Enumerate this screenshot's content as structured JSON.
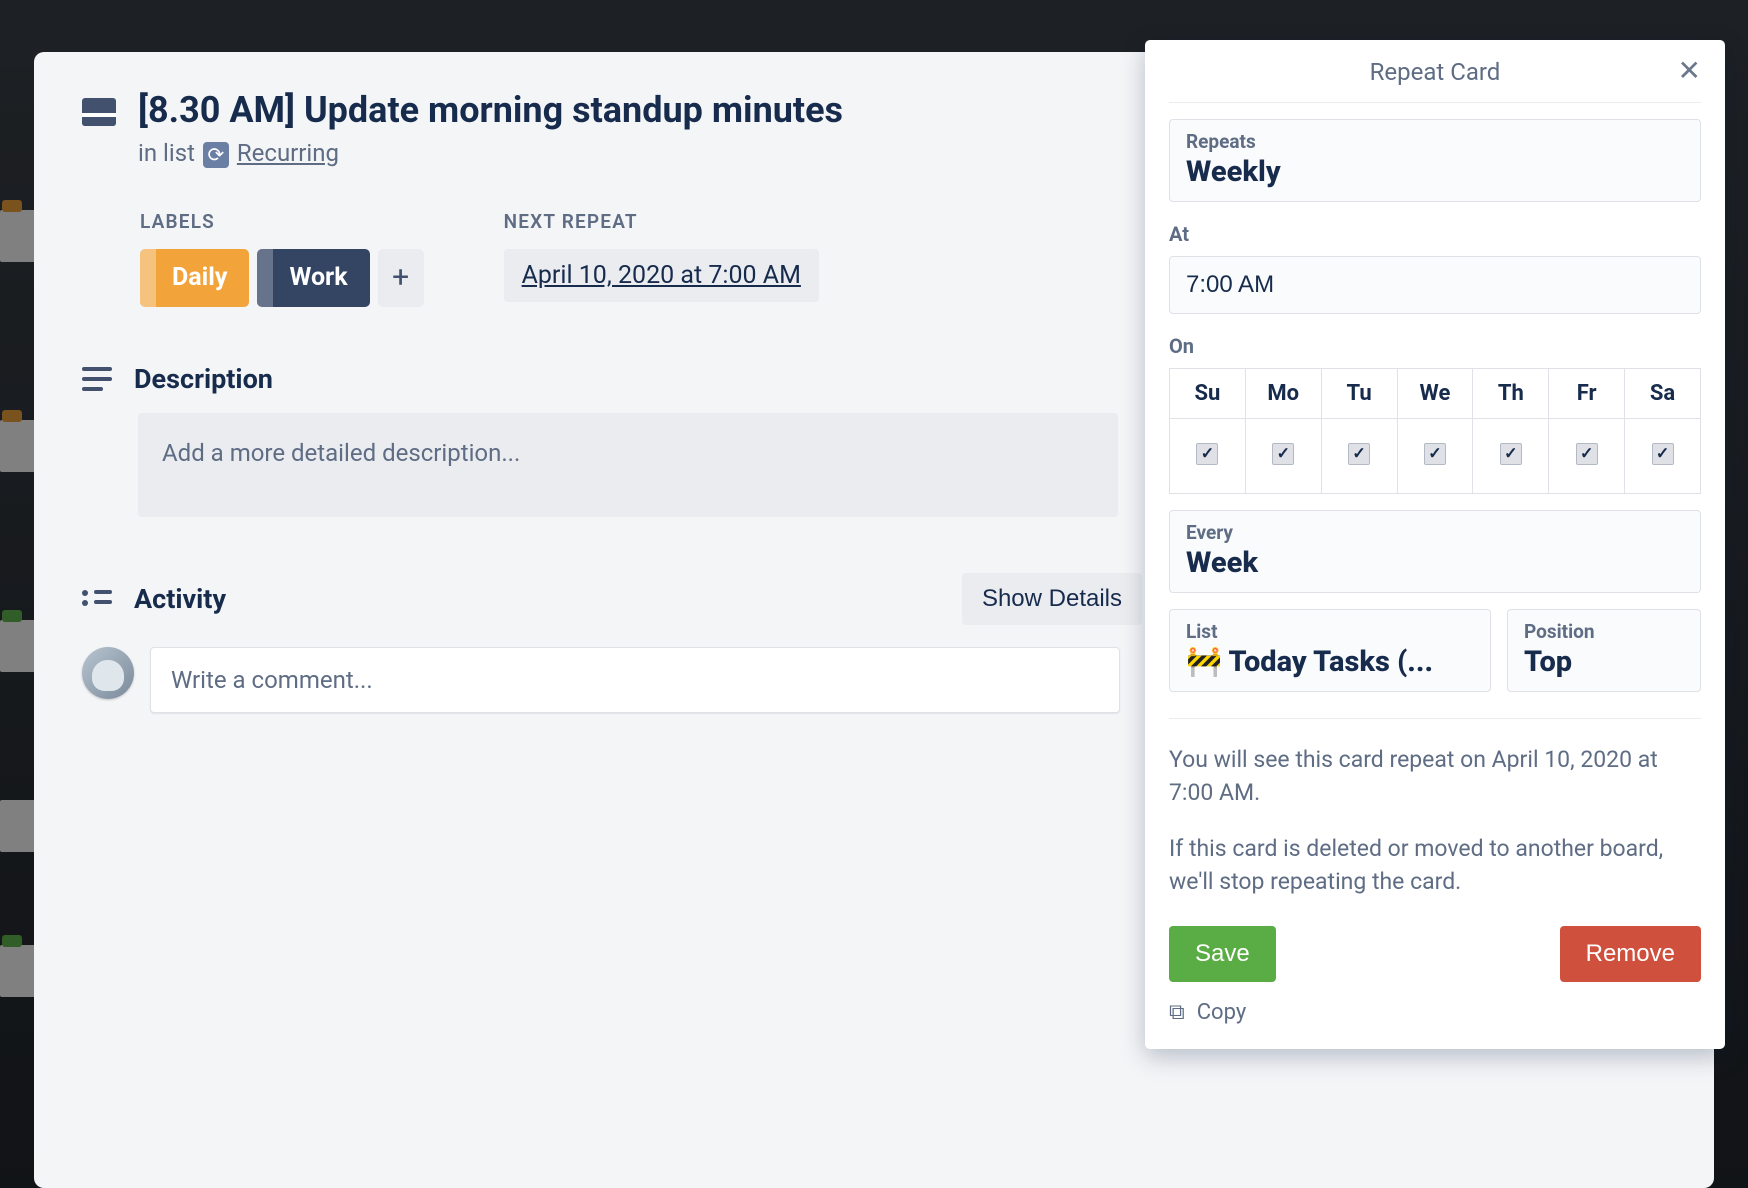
{
  "card": {
    "title": "[8.30 AM] Update morning standup minutes",
    "in_list_prefix": "in list ",
    "list_name": "Recurring"
  },
  "meta": {
    "labels_title": "LABELS",
    "labels": [
      {
        "text": "Daily",
        "color": "orange"
      },
      {
        "text": "Work",
        "color": "navy"
      }
    ],
    "next_repeat_title": "NEXT REPEAT",
    "next_repeat_value": "April 10, 2020 at 7:00 AM"
  },
  "description": {
    "title": "Description",
    "placeholder": "Add a more detailed description..."
  },
  "activity": {
    "title": "Activity",
    "show_details": "Show Details",
    "comment_placeholder": "Write a comment..."
  },
  "popover": {
    "title": "Repeat Card",
    "repeats_label": "Repeats",
    "repeats_value": "Weekly",
    "at_label": "At",
    "at_value": "7:00 AM",
    "on_label": "On",
    "days": [
      "Su",
      "Mo",
      "Tu",
      "We",
      "Th",
      "Fr",
      "Sa"
    ],
    "days_checked": [
      true,
      true,
      true,
      true,
      true,
      true,
      true
    ],
    "every_label": "Every",
    "every_value": "Week",
    "list_label": "List",
    "list_value": "🚧 Today Tasks (...",
    "position_label": "Position",
    "position_value": "Top",
    "info1": "You will see this card repeat on April 10, 2020 at 7:00 AM.",
    "info2": "If this card is deleted or moved to another board, we'll stop repeating the card.",
    "save": "Save",
    "remove": "Remove",
    "copy": "Copy"
  }
}
